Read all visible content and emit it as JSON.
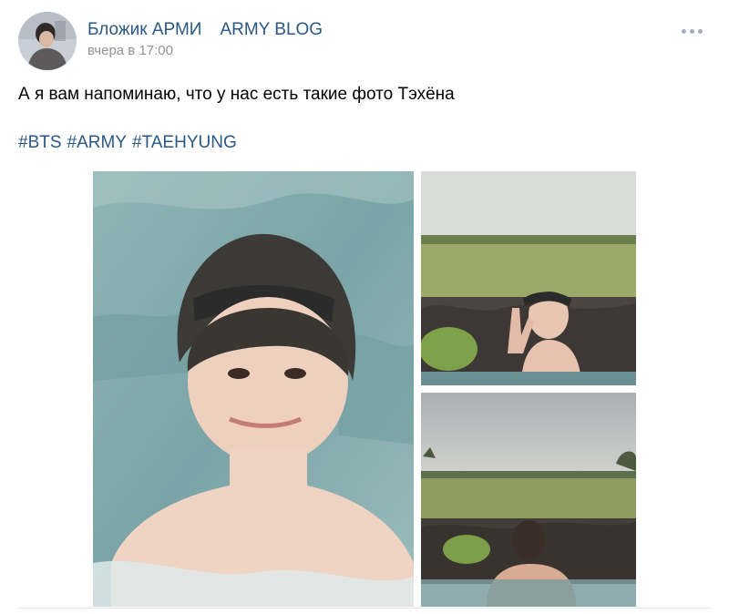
{
  "post": {
    "author_name": "Бложик АРМИ",
    "author_name_latin": "ARMY BLOG",
    "time": "вчера в 17:00",
    "text": "А я вам напоминаю, что у нас есть такие фото Тэхёна",
    "hashtags": [
      "#BTS",
      "#ARMY",
      "#TAEHYUNG"
    ],
    "more_icon": "more-horizontal-icon"
  },
  "colors": {
    "link": "#2a5885",
    "text": "#000000",
    "muted": "#939393"
  },
  "photos": [
    {
      "description_icon": "photo-underwater-portrait"
    },
    {
      "description_icon": "photo-pool-peace-sign"
    },
    {
      "description_icon": "photo-pool-back-view"
    }
  ]
}
